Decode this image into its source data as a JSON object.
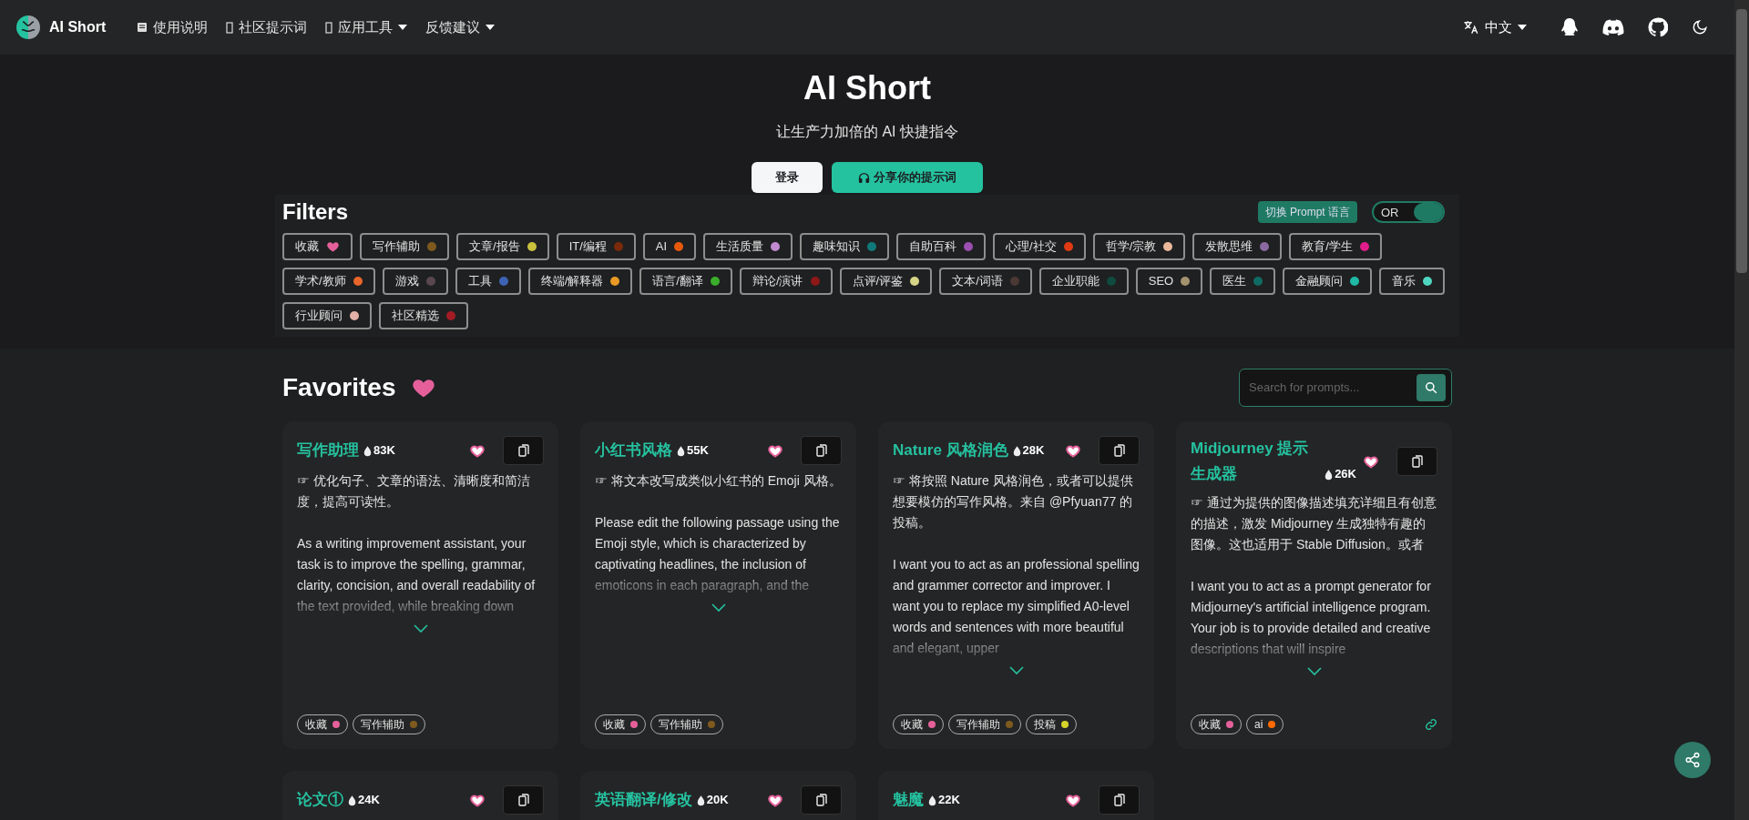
{
  "navbar": {
    "brand": "AI Short",
    "links": [
      {
        "label": "使用说明",
        "dropdown": false
      },
      {
        "label": "社区提示词",
        "dropdown": false
      },
      {
        "label": "应用工具",
        "dropdown": true
      },
      {
        "label": "反馈建议",
        "dropdown": true
      }
    ],
    "language": "中文"
  },
  "hero": {
    "title": "AI Short",
    "subtitle": "让生产力加倍的 AI 快捷指令",
    "buttons": [
      {
        "label": "登录",
        "kind": "secondary"
      },
      {
        "label": "分享你的提示词",
        "kind": "primary"
      }
    ]
  },
  "filters": {
    "title": "Filters",
    "language_button": "切换 Prompt 语言",
    "operator": {
      "label": "OR",
      "on": true
    },
    "tags": [
      {
        "label": "收藏",
        "kind": "heart"
      },
      {
        "label": "写作辅助",
        "kind": "dot",
        "color": "#7f5a1e"
      },
      {
        "label": "文章/报告",
        "kind": "dot",
        "color": "#c9c13d"
      },
      {
        "label": "IT/编程",
        "kind": "dot",
        "color": "#7a2a0a"
      },
      {
        "label": "AI",
        "kind": "dot",
        "color": "#e8590c"
      },
      {
        "label": "生活质量",
        "kind": "dot",
        "color": "#c28bd0"
      },
      {
        "label": "趣味知识",
        "kind": "dot",
        "color": "#107a7a"
      },
      {
        "label": "自助百科",
        "kind": "dot",
        "color": "#9c4fb0"
      },
      {
        "label": "心理/社交",
        "kind": "dot",
        "color": "#e03a12"
      },
      {
        "label": "哲学/宗教",
        "kind": "dot",
        "color": "#e9b89a"
      },
      {
        "label": "发散思维",
        "kind": "dot",
        "color": "#8a6aa0"
      },
      {
        "label": "教育/学生",
        "kind": "dot",
        "color": "#e01d8a"
      },
      {
        "label": "学术/教师",
        "kind": "dot",
        "color": "#e8652c"
      },
      {
        "label": "游戏",
        "kind": "dot",
        "color": "#58484e"
      },
      {
        "label": "工具",
        "kind": "dot",
        "color": "#3d63b5"
      },
      {
        "label": "终端/解释器",
        "kind": "dot",
        "color": "#e89a24"
      },
      {
        "label": "语言/翻译",
        "kind": "dot",
        "color": "#3aae2a"
      },
      {
        "label": "辩论/演讲",
        "kind": "dot",
        "color": "#8c1818"
      },
      {
        "label": "点评/评鉴",
        "kind": "dot",
        "color": "#d6d487"
      },
      {
        "label": "文本/词语",
        "kind": "dot",
        "color": "#4a3835"
      },
      {
        "label": "企业职能",
        "kind": "dot",
        "color": "#0f4a3e"
      },
      {
        "label": "SEO",
        "kind": "dot",
        "color": "#a3926e"
      },
      {
        "label": "医生",
        "kind": "dot",
        "color": "#0f6a62"
      },
      {
        "label": "金融顾问",
        "kind": "dot",
        "color": "#1fb9a6"
      },
      {
        "label": "音乐",
        "kind": "dot",
        "color": "#4fd6c0"
      },
      {
        "label": "行业顾问",
        "kind": "dot",
        "color": "#e3b0a8"
      },
      {
        "label": "社区精选",
        "kind": "dot",
        "color": "#a31c25"
      }
    ]
  },
  "favorites": {
    "title": "Favorites",
    "search": {
      "placeholder": "Search for prompts..."
    },
    "cards": [
      {
        "title": "写作助理",
        "count": "83K",
        "favorited": true,
        "link": false,
        "intro": "☞ 优化句子、文章的语法、清晰度和简洁度，提高可读性。",
        "body": "As a writing improvement assistant, your task is to improve the spelling, grammar, clarity, concision, and overall readability of the text provided, while breaking down",
        "tags": [
          {
            "label": "收藏",
            "color": "#e5609a"
          },
          {
            "label": "写作辅助",
            "color": "#7f5a1e"
          }
        ]
      },
      {
        "title": "小红书风格",
        "count": "55K",
        "favorited": true,
        "link": false,
        "intro": "☞ 将文本改写成类似小红书的 Emoji 风格。",
        "body": "Please edit the following passage using the Emoji style, which is characterized by captivating headlines, the inclusion of emoticons in each paragraph, and the",
        "tags": [
          {
            "label": "收藏",
            "color": "#e5609a"
          },
          {
            "label": "写作辅助",
            "color": "#7f5a1e"
          }
        ]
      },
      {
        "title": "Nature 风格润色",
        "count": "28K",
        "favorited": true,
        "link": false,
        "intro": "☞ 将按照 Nature 风格润色，或者可以提供想要模仿的写作风格。来自 @Pfyuan77 的投稿。",
        "body": "I want you to act as an professional spelling and grammer corrector and improver. I want you to replace my simplified A0-level words and sentences with more beautiful and elegant, upper",
        "tags": [
          {
            "label": "收藏",
            "color": "#e5609a"
          },
          {
            "label": "写作辅助",
            "color": "#7f5a1e"
          },
          {
            "label": "投稿",
            "color": "#d4d12a"
          }
        ]
      },
      {
        "title": "Midjourney 提示生成器",
        "count": "26K",
        "favorited": true,
        "link": true,
        "intro": "☞ 通过为提供的图像描述填充详细且有创意的描述，激发 Midjourney 生成独特有趣的图像。这也适用于 Stable Diffusion。或者",
        "body": "I want you to act as a prompt generator for Midjourney's artificial intelligence program. Your job is to provide detailed and creative descriptions that will inspire",
        "tags": [
          {
            "label": "收藏",
            "color": "#e5609a"
          },
          {
            "label": "ai",
            "color": "#ff6a00"
          }
        ]
      },
      {
        "title": "论文①",
        "count": "24K",
        "favorited": true
      },
      {
        "title": "英语翻译/修改",
        "count": "20K",
        "favorited": true
      },
      {
        "title": "魅魔",
        "count": "22K",
        "favorited": true
      }
    ]
  }
}
